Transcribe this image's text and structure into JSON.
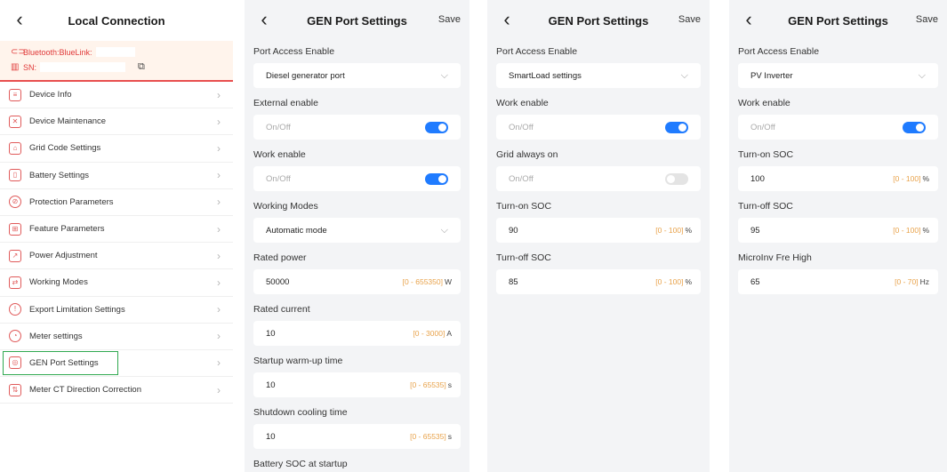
{
  "panel1": {
    "title": "Local Connection",
    "bluetooth_label": "Bluetooth:BlueLink:",
    "sn_label": "SN:",
    "menu": [
      {
        "label": "Device Info",
        "icon": "document-icon"
      },
      {
        "label": "Device Maintenance",
        "icon": "tools-icon"
      },
      {
        "label": "Grid Code Settings",
        "icon": "grid-code-icon"
      },
      {
        "label": "Battery Settings",
        "icon": "battery-icon"
      },
      {
        "label": "Protection Parameters",
        "icon": "protection-icon"
      },
      {
        "label": "Feature Parameters",
        "icon": "feature-icon"
      },
      {
        "label": "Power Adjustment",
        "icon": "power-adjust-icon"
      },
      {
        "label": "Working Modes",
        "icon": "working-modes-icon"
      },
      {
        "label": "Export Limitation Settings",
        "icon": "export-limit-icon"
      },
      {
        "label": "Meter settings",
        "icon": "meter-icon"
      },
      {
        "label": "GEN Port Settings",
        "icon": "gen-port-icon"
      },
      {
        "label": "Meter CT Direction Correction",
        "icon": "ct-direction-icon"
      }
    ]
  },
  "panel2": {
    "title": "GEN Port Settings",
    "save": "Save",
    "port_access_label": "Port Access Enable",
    "port_access_value": "Diesel generator port",
    "external_enable_label": "External enable",
    "external_enable_text": "On/Off",
    "external_enable_on": true,
    "work_enable_label": "Work enable",
    "work_enable_text": "On/Off",
    "work_enable_on": true,
    "working_modes_label": "Working Modes",
    "working_modes_value": "Automatic mode",
    "rated_power_label": "Rated power",
    "rated_power_value": "50000",
    "rated_power_range": "[0 - 655350]",
    "rated_power_unit": "W",
    "rated_current_label": "Rated current",
    "rated_current_value": "10",
    "rated_current_range": "[0 - 3000]",
    "rated_current_unit": "A",
    "warmup_label": "Startup warm-up time",
    "warmup_value": "10",
    "warmup_range": "[0 - 65535]",
    "warmup_unit": "s",
    "cooling_label": "Shutdown cooling time",
    "cooling_value": "10",
    "cooling_range": "[0 - 65535]",
    "cooling_unit": "s",
    "battery_soc_label": "Battery SOC at startup"
  },
  "panel3": {
    "title": "GEN Port Settings",
    "save": "Save",
    "port_access_label": "Port Access Enable",
    "port_access_value": "SmartLoad settings",
    "work_enable_label": "Work enable",
    "work_enable_text": "On/Off",
    "work_enable_on": true,
    "grid_always_label": "Grid always on",
    "grid_always_text": "On/Off",
    "grid_always_on": false,
    "turn_on_label": "Turn-on SOC",
    "turn_on_value": "90",
    "turn_on_range": "[0 - 100]",
    "turn_on_unit": "%",
    "turn_off_label": "Turn-off SOC",
    "turn_off_value": "85",
    "turn_off_range": "[0 - 100]",
    "turn_off_unit": "%"
  },
  "panel4": {
    "title": "GEN Port Settings",
    "save": "Save",
    "port_access_label": "Port Access Enable",
    "port_access_value": "PV Inverter",
    "work_enable_label": "Work enable",
    "work_enable_text": "On/Off",
    "work_enable_on": true,
    "turn_on_label": "Turn-on SOC",
    "turn_on_value": "100",
    "turn_on_range": "[0 - 100]",
    "turn_on_unit": "%",
    "turn_off_label": "Turn-off SOC",
    "turn_off_value": "95",
    "turn_off_range": "[0 - 100]",
    "turn_off_unit": "%",
    "microinv_label": "MicroInv Fre High",
    "microinv_value": "65",
    "microinv_range": "[0 - 70]",
    "microinv_unit": "Hz"
  },
  "colors": {
    "accent_blue": "#1f7bff",
    "brand_red": "#e03a3a",
    "range_orange": "#e8a24a",
    "highlight_green": "#2fa84f"
  }
}
